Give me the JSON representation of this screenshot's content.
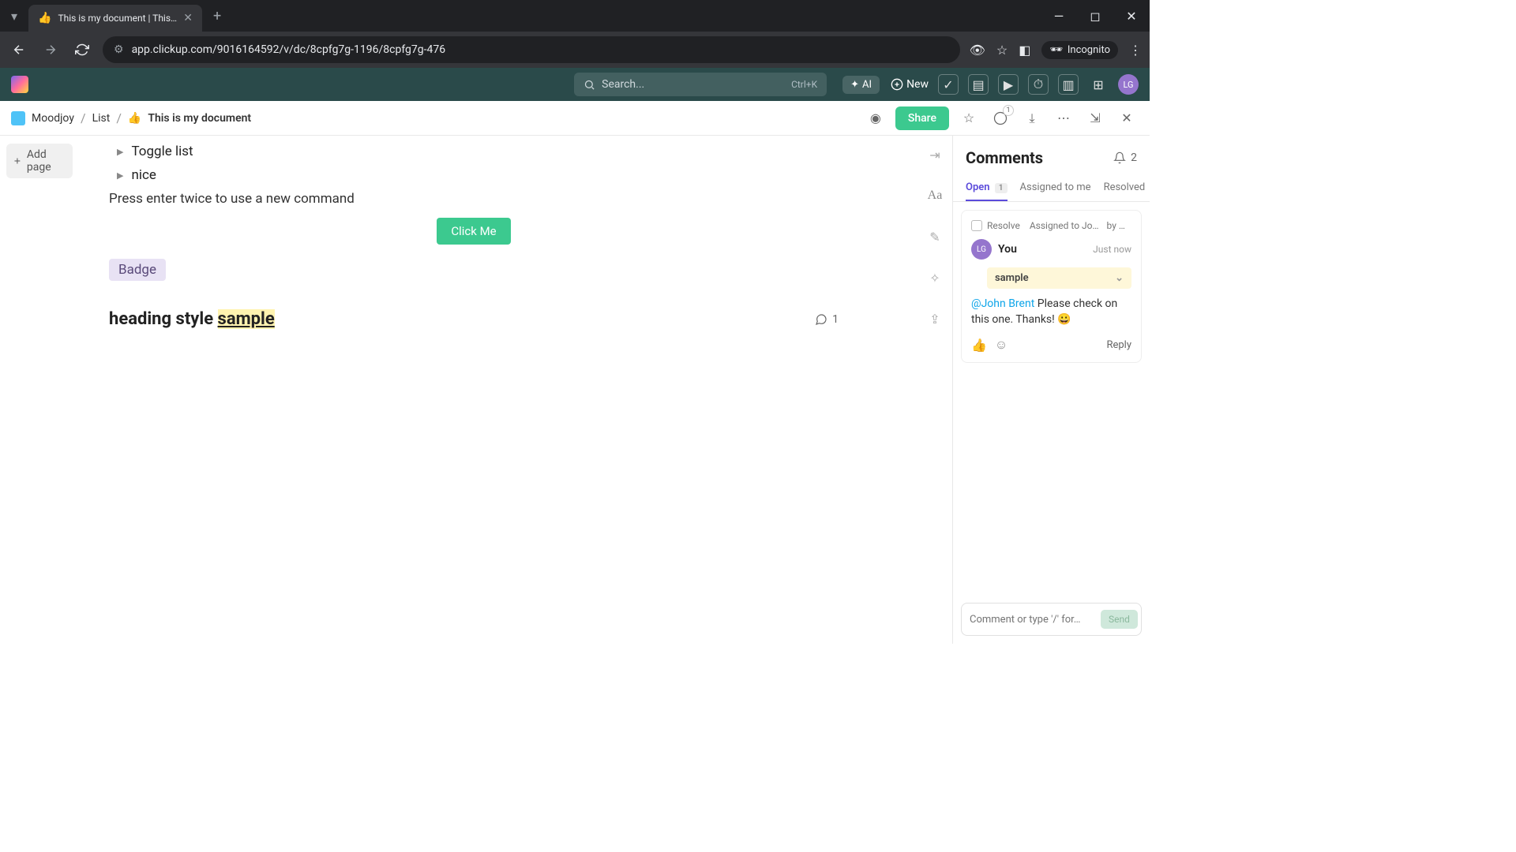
{
  "browser": {
    "tab_title": "This is my document | This is m",
    "tab_emoji": "👍",
    "url": "app.clickup.com/9016164592/v/dc/8cpfg7g-1196/8cpfg7g-476",
    "incognito": "Incognito"
  },
  "app_header": {
    "search_placeholder": "Search...",
    "search_kbd": "Ctrl+K",
    "ai_label": "AI",
    "new_label": "New",
    "avatar_initials": "LG"
  },
  "breadcrumb": {
    "workspace": "Moodjoy",
    "list": "List",
    "doc_emoji": "👍",
    "doc_title": "This is my document",
    "share": "Share",
    "notif_count": "1"
  },
  "sidebar": {
    "add_page": "Add page"
  },
  "doc": {
    "toggle1": "Toggle list",
    "toggle2": "nice",
    "hint": "Press enter twice to use a new command",
    "button": "Click Me",
    "badge": "Badge",
    "heading_prefix": "heading style ",
    "heading_hl": "sample",
    "comment_count": "1"
  },
  "comments": {
    "title": "Comments",
    "bell_count": "2",
    "tabs": {
      "open": "Open",
      "open_count": "1",
      "assigned": "Assigned to me",
      "resolved": "Resolved"
    },
    "card": {
      "resolve": "Resolve",
      "assigned_to": "Assigned to Jo…",
      "by": "by …",
      "author_initials": "LG",
      "author": "You",
      "time": "Just now",
      "quote": "sample",
      "mention": "@John Brent",
      "body": " Please check on this one. Thanks! 😀",
      "reply": "Reply"
    },
    "input_placeholder": "Comment or type '/' for…",
    "send": "Send"
  }
}
